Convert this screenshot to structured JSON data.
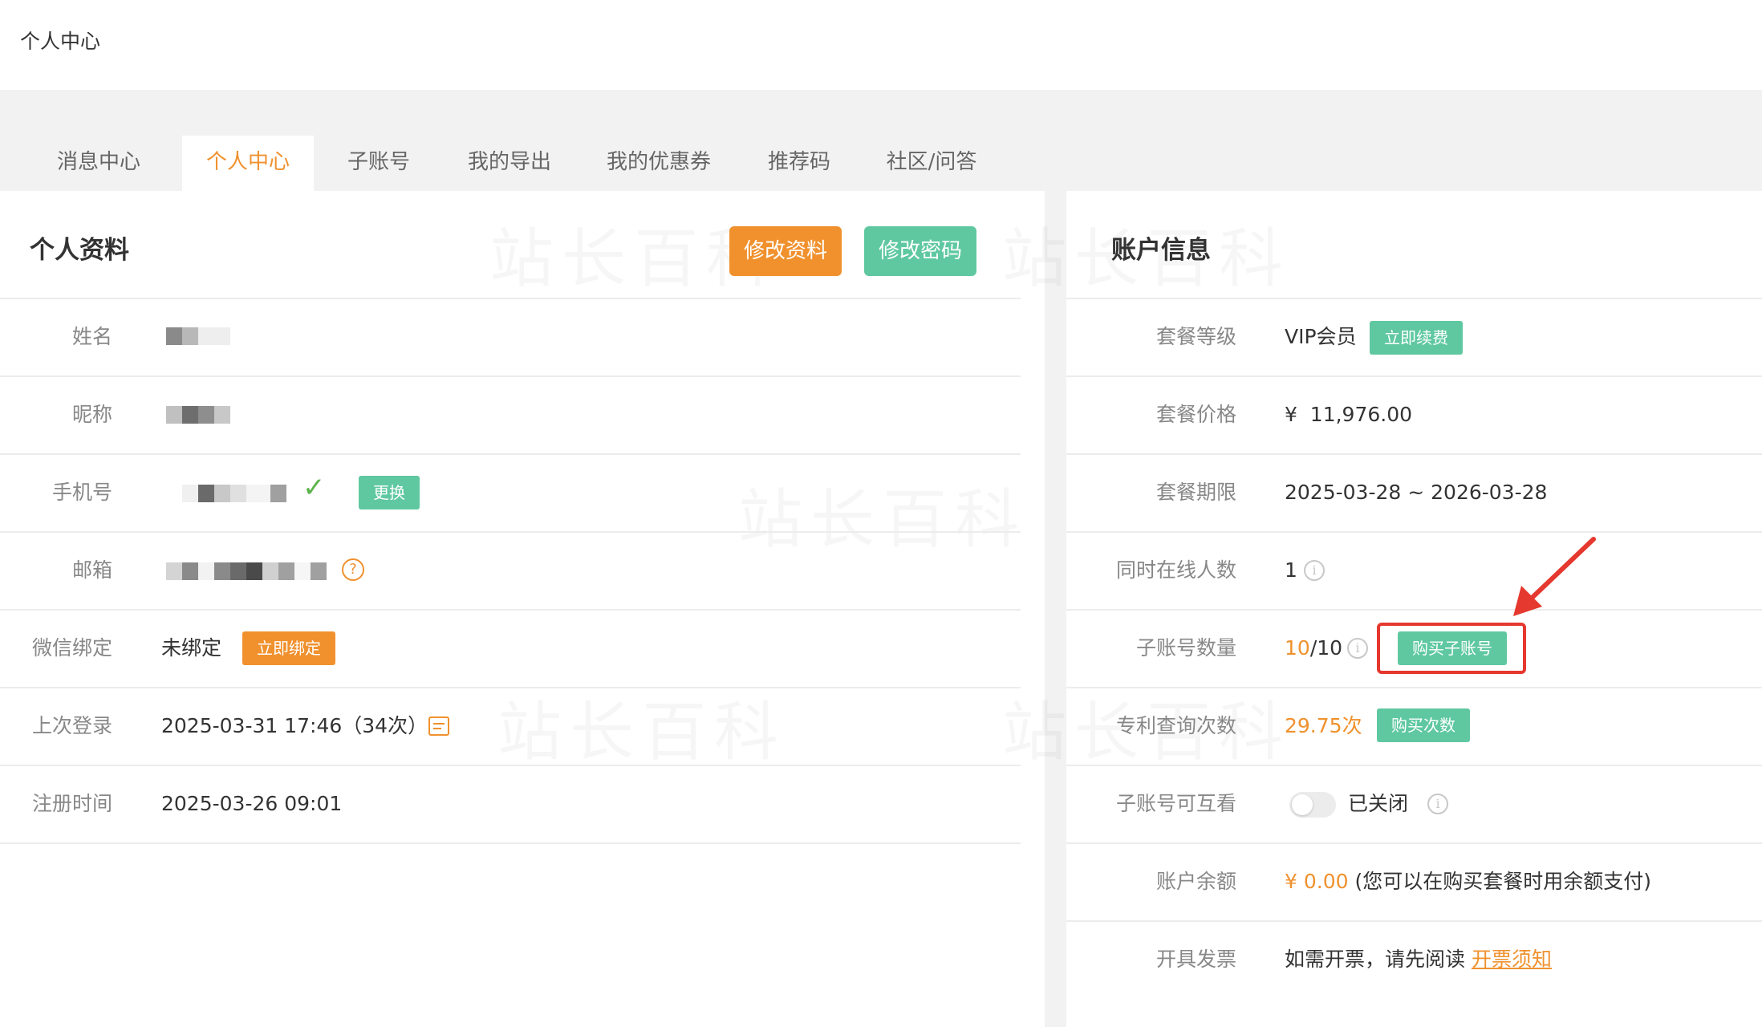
{
  "page": {
    "title": "个人中心"
  },
  "tabs": [
    {
      "label": "消息中心"
    },
    {
      "label": "个人中心"
    },
    {
      "label": "子账号"
    },
    {
      "label": "我的导出"
    },
    {
      "label": "我的优惠券"
    },
    {
      "label": "推荐码"
    },
    {
      "label": "社区/问答"
    }
  ],
  "watermark": "站长百科",
  "profile": {
    "title": "个人资料",
    "edit_button": "修改资料",
    "password_button": "修改密码",
    "rows": {
      "name": {
        "label": "姓名"
      },
      "nickname": {
        "label": "昵称"
      },
      "phone": {
        "label": "手机号",
        "action": "更换"
      },
      "email": {
        "label": "邮箱",
        "help": "?"
      },
      "wechat": {
        "label": "微信绑定",
        "value": "未绑定",
        "action": "立即绑定"
      },
      "last_login": {
        "label": "上次登录",
        "value": "2025-03-31 17:46（34次）"
      },
      "register": {
        "label": "注册时间",
        "value": "2025-03-26 09:01"
      }
    }
  },
  "account": {
    "title": "账户信息",
    "rows": {
      "plan_level": {
        "label": "套餐等级",
        "value": "VIP会员",
        "action": "立即续费"
      },
      "plan_price": {
        "label": "套餐价格",
        "value": "¥  11,976.00"
      },
      "plan_period": {
        "label": "套餐期限",
        "value": "2025-03-28 ~ 2026-03-28"
      },
      "online_users": {
        "label": "同时在线人数",
        "value": "1"
      },
      "sub_accounts": {
        "label": "子账号数量",
        "used": "10",
        "total": "/10",
        "action": "购买子账号"
      },
      "patent_queries": {
        "label": "专利查询次数",
        "value": "29.75次",
        "action": "购买次数"
      },
      "sub_visibility": {
        "label": "子账号可互看",
        "state": "已关闭"
      },
      "balance": {
        "label": "账户余额",
        "amount": "¥ 0.00",
        "note": "(您可以在购买套餐时用余额支付)"
      },
      "invoice": {
        "label": "开具发票",
        "text": "如需开票，请先阅读",
        "link": "开票须知"
      }
    }
  },
  "colors": {
    "accent_orange": "#f0912e",
    "accent_green": "#5fc8a1",
    "annotation_red": "#e5382e"
  }
}
